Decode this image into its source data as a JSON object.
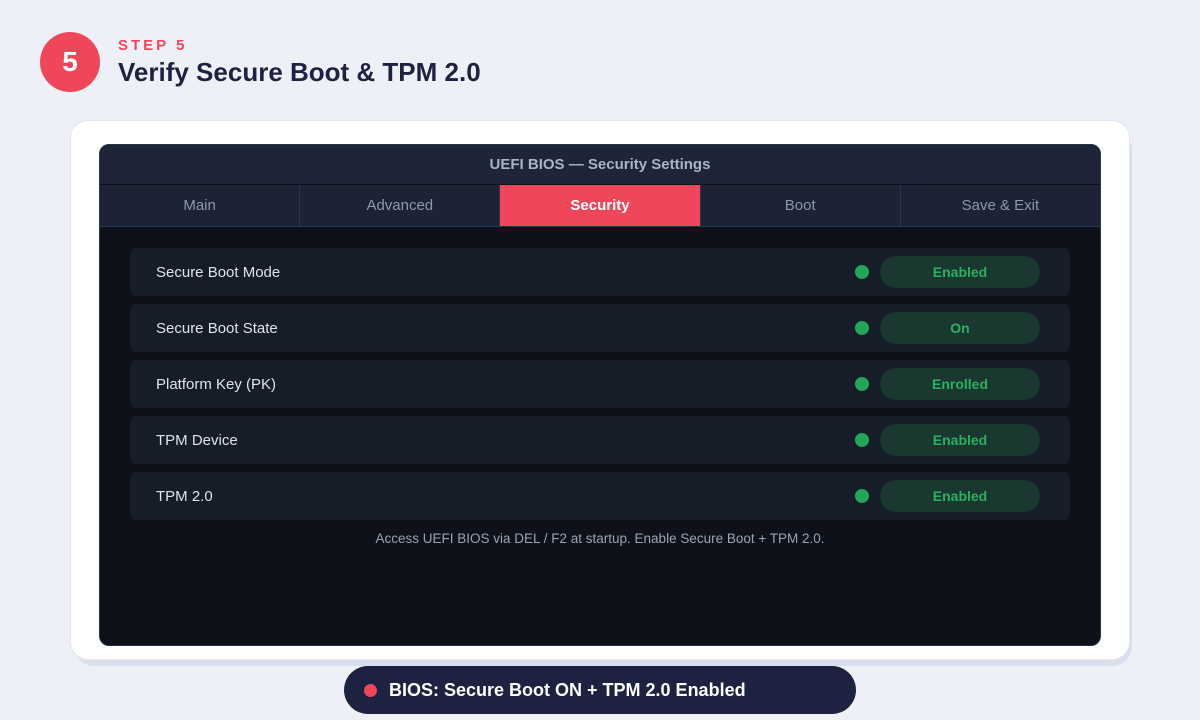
{
  "step": {
    "number": "5",
    "kicker": "STEP 5",
    "title": "Verify Secure Boot & TPM 2.0"
  },
  "bios": {
    "window_title": "UEFI BIOS — Security Settings",
    "tabs": [
      {
        "label": "Main",
        "active": false
      },
      {
        "label": "Advanced",
        "active": false
      },
      {
        "label": "Security",
        "active": true
      },
      {
        "label": "Boot",
        "active": false
      },
      {
        "label": "Save & Exit",
        "active": false
      }
    ],
    "settings": [
      {
        "label": "Secure Boot Mode",
        "value": "Enabled"
      },
      {
        "label": "Secure Boot State",
        "value": "On"
      },
      {
        "label": "Platform Key (PK)",
        "value": "Enrolled"
      },
      {
        "label": "TPM Device",
        "value": "Enabled"
      },
      {
        "label": "TPM 2.0",
        "value": "Enabled"
      }
    ],
    "hint": "Access UEFI BIOS via DEL / F2 at startup. Enable Secure Boot + TPM 2.0."
  },
  "summary": {
    "text": "BIOS: Secure Boot ON + TPM 2.0 Enabled"
  },
  "colors": {
    "accent": "#f0465a",
    "status_green": "#22a55a",
    "bios_background": "#0d111a",
    "summary_background": "#1d2240"
  }
}
